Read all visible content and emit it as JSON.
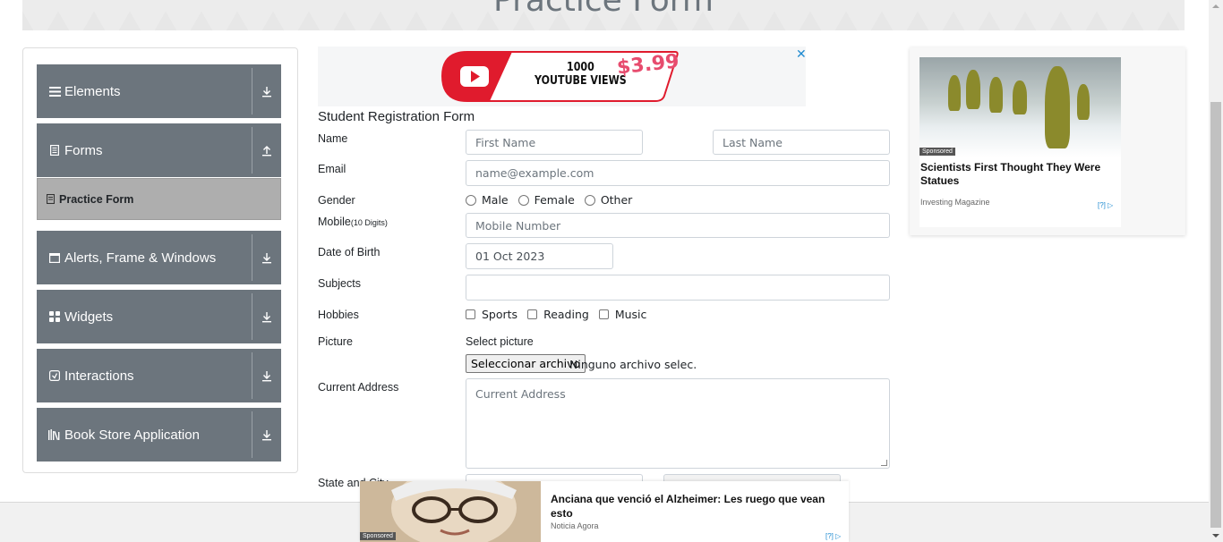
{
  "header": {
    "title": "Practice Form"
  },
  "sidebar": {
    "groups": [
      {
        "label": "Elements",
        "icon": "hamburger-icon",
        "arrow": "download-arrow-icon"
      },
      {
        "label": "Forms",
        "icon": "document-icon",
        "arrow": "upload-arrow-icon"
      },
      {
        "label": "Alerts, Frame & Windows",
        "icon": "window-icon",
        "arrow": "download-arrow-icon"
      },
      {
        "label": "Widgets",
        "icon": "grid-icon",
        "arrow": "download-arrow-icon"
      },
      {
        "label": "Interactions",
        "icon": "interaction-icon",
        "arrow": "download-arrow-icon"
      },
      {
        "label": "Book Store Application",
        "icon": "books-icon",
        "arrow": "download-arrow-icon"
      }
    ],
    "sub_item": {
      "label": "Practice Form",
      "icon": "document-small-icon"
    }
  },
  "top_ad": {
    "line1": "1000",
    "line2": "YOUTUBE VIEWS",
    "price": "$3.99",
    "close": "✕"
  },
  "form": {
    "title": "Student Registration Form",
    "name_label": "Name",
    "first_name_placeholder": "First Name",
    "last_name_placeholder": "Last Name",
    "email_label": "Email",
    "email_placeholder": "name@example.com",
    "gender_label": "Gender",
    "gender_options": [
      "Male",
      "Female",
      "Other"
    ],
    "mobile_label": "Mobile",
    "mobile_hint": "(10 Digits)",
    "mobile_placeholder": "Mobile Number",
    "dob_label": "Date of Birth",
    "dob_value": "01 Oct 2023",
    "subjects_label": "Subjects",
    "hobbies_label": "Hobbies",
    "hobbies_options": [
      "Sports",
      "Reading",
      "Music"
    ],
    "picture_label": "Picture",
    "picture_prompt": "Select picture",
    "file_button": "Seleccionar archivo",
    "file_status": "Ninguno archivo selec.",
    "address_label": "Current Address",
    "address_placeholder": "Current Address",
    "state_city_label": "State and City"
  },
  "side_ad": {
    "badge": "Sponsored",
    "headline": "Scientists First Thought They Were Statues",
    "source": "Investing Magazine",
    "choices": "[?]"
  },
  "bottom_ad": {
    "badge": "Sponsored",
    "headline": "Anciana que venció el Alzheimer: Les ruego que vean esto",
    "source": "Noticia Agora",
    "choices": "[?]"
  },
  "colors": {
    "menu_bg": "#6c757d",
    "sub_item_bg": "#aeaeae",
    "accent": "#1f8bd1"
  }
}
